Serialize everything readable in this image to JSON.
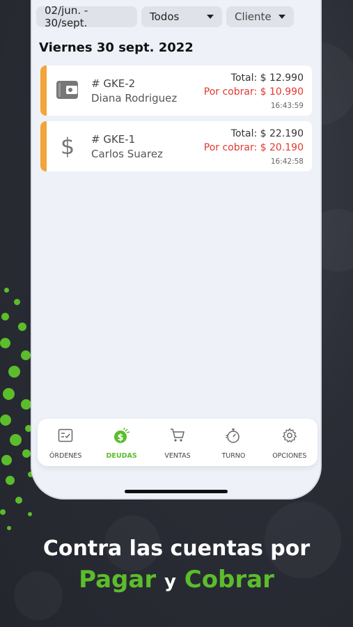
{
  "filters": {
    "date_range": "02/jun. - 30/sept.",
    "status_select": "Todos",
    "client_select": "Cliente"
  },
  "date_header": "Viernes 30 sept. 2022",
  "orders": [
    {
      "icon": "wallet-icon",
      "code": "# GKE-2",
      "client": "Diana Rodriguez",
      "total": "Total: $ 12.990",
      "pending": "Por cobrar: $ 10.990",
      "time": "16:43:59"
    },
    {
      "icon": "dollar-icon",
      "code": "# GKE-1",
      "client": "Carlos Suarez",
      "total": "Total: $ 22.190",
      "pending": "Por cobrar: $ 20.190",
      "time": "16:42:58"
    }
  ],
  "tabs": [
    {
      "label": "ÓRDENES",
      "icon": "orders-icon",
      "active": false
    },
    {
      "label": "DEUDAS",
      "icon": "debts-icon",
      "active": true
    },
    {
      "label": "VENTAS",
      "icon": "cart-icon",
      "active": false
    },
    {
      "label": "TURNO",
      "icon": "stopwatch-icon",
      "active": false
    },
    {
      "label": "OPCIONES",
      "icon": "gear-icon",
      "active": false
    }
  ],
  "caption": {
    "line1": "Contra las cuentas por",
    "word_pay": "Pagar",
    "word_and": "y",
    "word_collect": "Cobrar"
  },
  "colors": {
    "accent_green": "#5bbd2b",
    "order_bar": "#f2a53a",
    "pending_red": "#e3372f"
  }
}
